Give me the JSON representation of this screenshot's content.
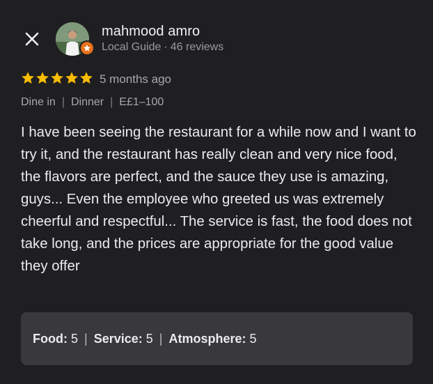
{
  "reviewer": {
    "name": "mahmood amro",
    "badge": "Local Guide",
    "separator": "·",
    "reviews": "46 reviews"
  },
  "review": {
    "stars": 5,
    "max_stars": 5,
    "date": "5 months ago",
    "tags": [
      "Dine in",
      "Dinner",
      "E£1–100"
    ],
    "text": "I have been seeing the restaurant for a while now and I want to try it, and the restaurant has really clean and very nice food, the flavors are perfect, and the sauce they use is amazing, guys... Even the employee who greeted us was extremely cheerful and respectful... The service is fast, the food does not take long, and the prices are appropriate for the good value they offer"
  },
  "ratings": [
    {
      "label": "Food:",
      "value": "5"
    },
    {
      "label": "Service:",
      "value": "5"
    },
    {
      "label": "Atmosphere:",
      "value": "5"
    }
  ],
  "icons": {
    "close": "close-icon",
    "star": "star-icon",
    "badge": "local-guide-icon"
  },
  "colors": {
    "background": "#1f1f21",
    "star": "#fbbc04",
    "badge": "#e8711c",
    "card": "#38383d"
  }
}
